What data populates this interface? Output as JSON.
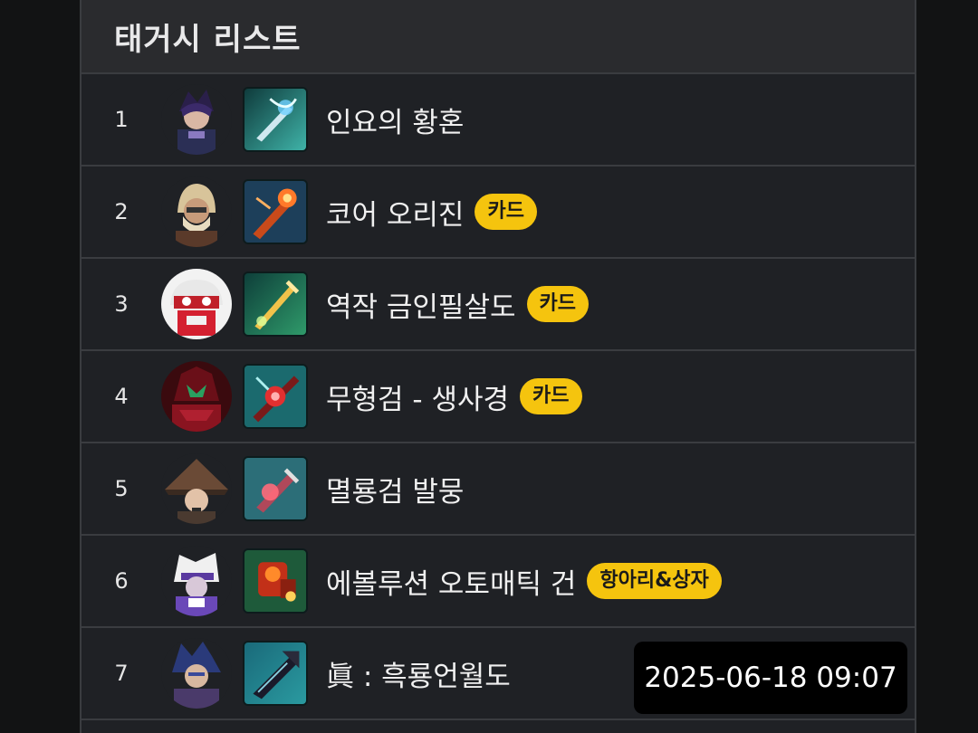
{
  "list": {
    "title": "태거시 리스트",
    "items": [
      {
        "rank": "1",
        "name": "인요의 황혼",
        "tag": ""
      },
      {
        "rank": "2",
        "name": "코어 오리진",
        "tag": "카드"
      },
      {
        "rank": "3",
        "name": "역작 금인필살도",
        "tag": "카드"
      },
      {
        "rank": "4",
        "name": "무형검 - 생사경",
        "tag": "카드"
      },
      {
        "rank": "5",
        "name": "멸룡검 발뭉",
        "tag": ""
      },
      {
        "rank": "6",
        "name": "에볼루션 오토매틱 건",
        "tag": "항아리&상자"
      },
      {
        "rank": "7",
        "name": "眞 : 흑룡언월도",
        "tag": ""
      }
    ]
  },
  "overlay": {
    "timestamp": "2025-06-18 09:07"
  },
  "colors": {
    "badge": "#f5c40e",
    "panel": "#1f2125",
    "header": "#2a2b2e"
  }
}
